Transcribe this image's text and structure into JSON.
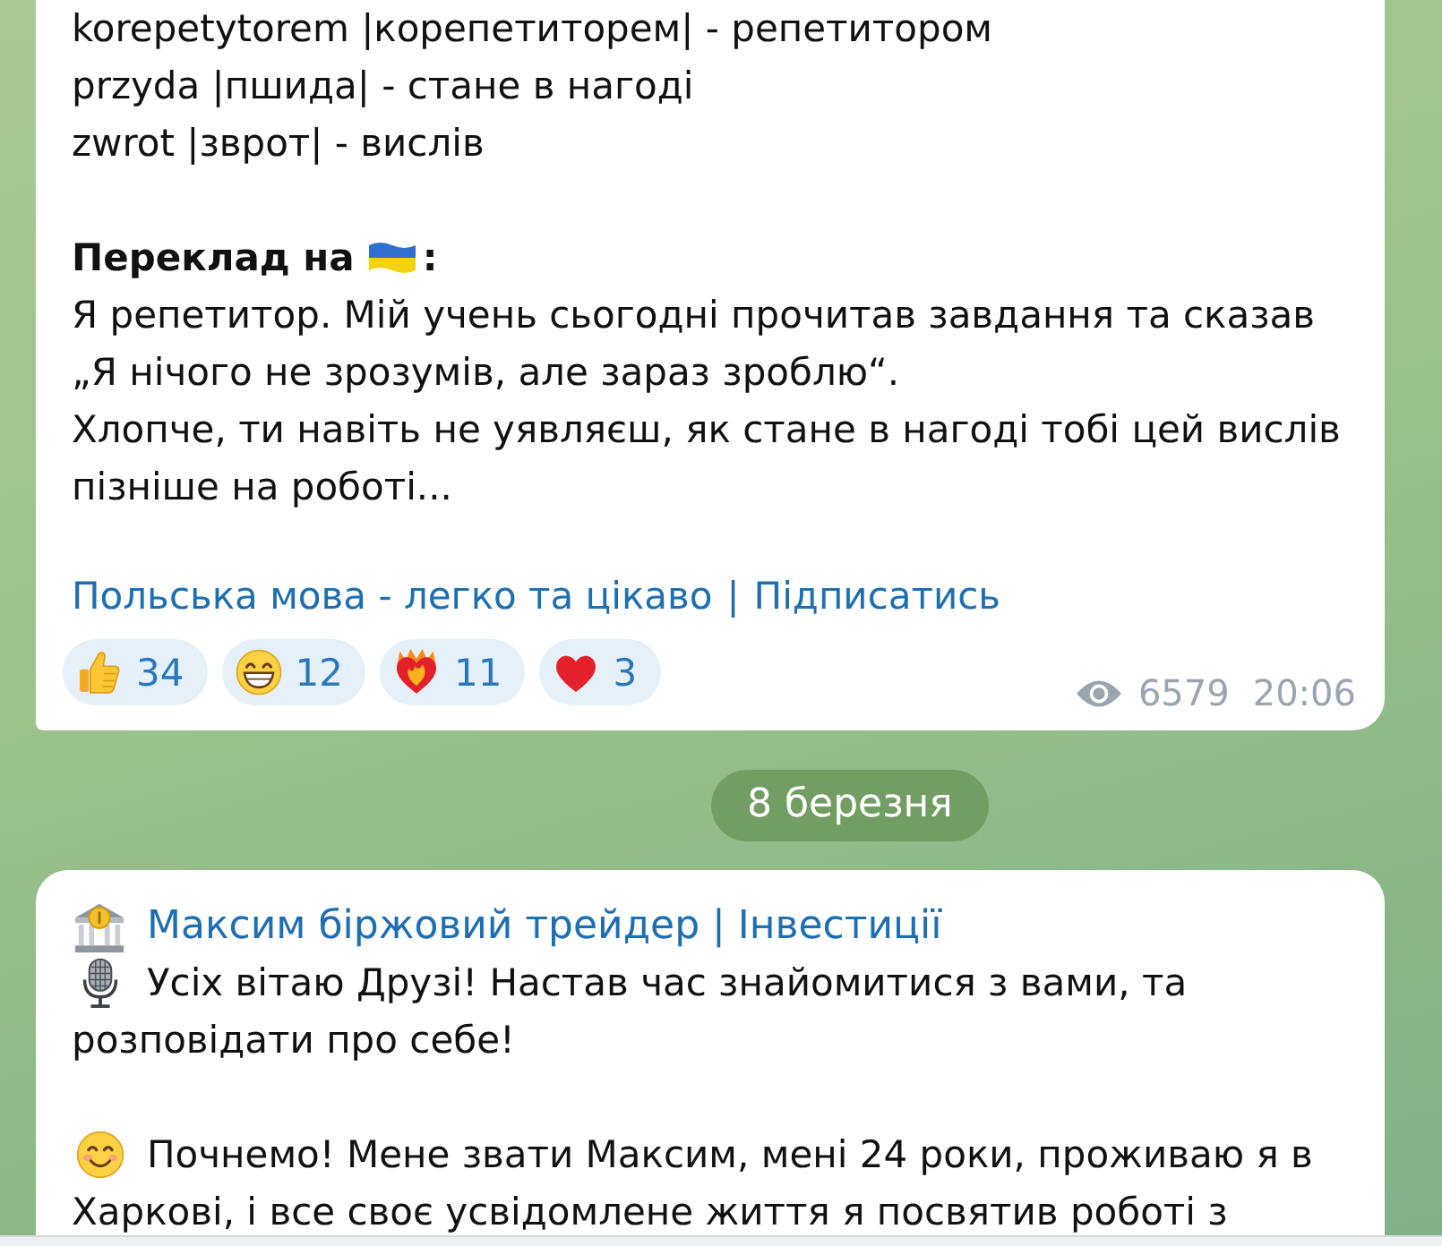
{
  "message_1": {
    "vocabulary": [
      "korepetytorem |корепетиторем| - репетитором",
      "przyda |пшида| - стане в нагоді",
      "zwrot |зврот| - вислів"
    ],
    "translation_heading": {
      "text": "Переклад на",
      "suffix": ":"
    },
    "translation": [
      [
        "Я репетитор. Мій учень сьогодні прочитав завдання та сказав",
        "„Я нічого не зрозумів, але зараз зроблю“."
      ],
      [
        "Хлопче, ти навіть не уявляєш, як стане в нагоді тобі цей вислів",
        "пізніше на роботі..."
      ]
    ],
    "channel_link": "Польська мова - легко та цікаво",
    "link_separator": "|",
    "subscribe_link": "Підписатись",
    "reactions": [
      {
        "kind": "thumbsup",
        "count": "34",
        "selected": false
      },
      {
        "kind": "grin",
        "count": "12",
        "selected": false
      },
      {
        "kind": "fireheart",
        "count": "11",
        "selected": false
      },
      {
        "kind": "heart",
        "count": "3",
        "selected": false
      }
    ],
    "views": "6579",
    "time": "20:06"
  },
  "date_separator": "8 березня",
  "message_2": {
    "author": "Максим біржовий трейдер | Інвестиції",
    "paragraphs": [
      {
        "kind": "microphone",
        "lines": [
          "Усіх вітаю Друзі! Настав час знайомитися з вами, та",
          "розповідати про себе!"
        ]
      },
      {
        "kind": "smile",
        "lines": [
          "Почнемо! Мене звати Максим, мені 24 роки, проживаю я в",
          "Харкові, і все своє усвідомлене життя я посвятив роботі з"
        ]
      }
    ]
  }
}
